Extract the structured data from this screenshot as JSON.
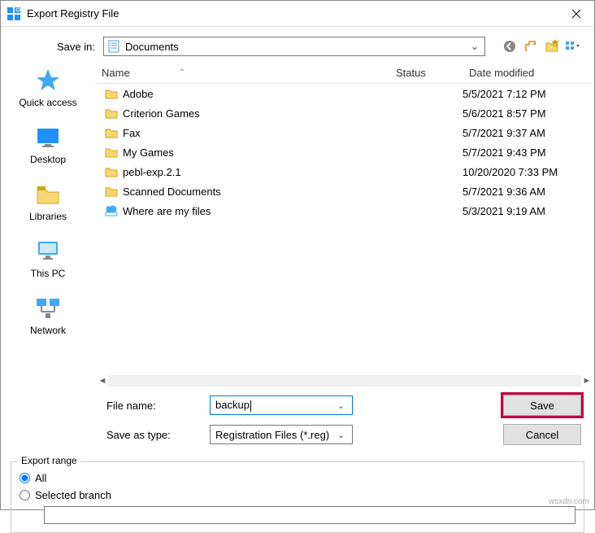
{
  "window": {
    "title": "Export Registry File"
  },
  "savein": {
    "label": "Save in:",
    "value": "Documents"
  },
  "columns": {
    "name": "Name",
    "status": "Status",
    "date": "Date modified"
  },
  "files": [
    {
      "name": "Adobe",
      "type": "folder",
      "date": "5/5/2021 7:12 PM"
    },
    {
      "name": "Criterion Games",
      "type": "folder",
      "date": "5/6/2021 8:57 PM"
    },
    {
      "name": "Fax",
      "type": "folder",
      "date": "5/7/2021 9:37 AM"
    },
    {
      "name": "My Games",
      "type": "folder",
      "date": "5/7/2021 9:43 PM"
    },
    {
      "name": "pebl-exp.2.1",
      "type": "folder",
      "date": "10/20/2020 7:33 PM"
    },
    {
      "name": "Scanned Documents",
      "type": "folder",
      "date": "5/7/2021 9:36 AM"
    },
    {
      "name": "Where are my files",
      "type": "link",
      "date": "5/3/2021 9:19 AM"
    }
  ],
  "sidebar": [
    {
      "label": "Quick access"
    },
    {
      "label": "Desktop"
    },
    {
      "label": "Libraries"
    },
    {
      "label": "This PC"
    },
    {
      "label": "Network"
    }
  ],
  "filename": {
    "label": "File name:",
    "value": "backup"
  },
  "saveas": {
    "label": "Save as type:",
    "value": "Registration Files (*.reg)"
  },
  "buttons": {
    "save": "Save",
    "cancel": "Cancel"
  },
  "export": {
    "legend": "Export range",
    "all": "All",
    "selected": "Selected branch",
    "branch_value": ""
  },
  "watermark": "wsxdn.com"
}
